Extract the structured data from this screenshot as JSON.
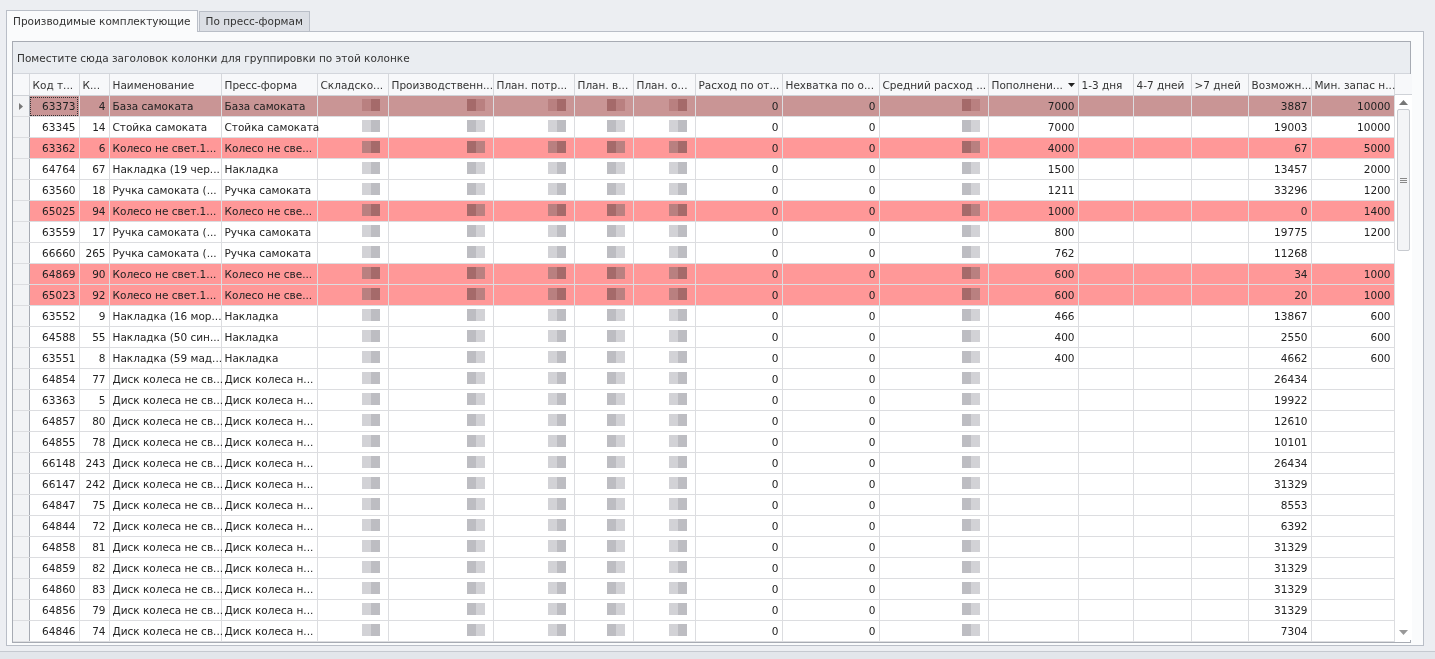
{
  "tabs": [
    {
      "label": "Производимые комплектующие",
      "selected": true
    },
    {
      "label": "По пресс-формам",
      "selected": false
    }
  ],
  "group_panel": {
    "hint": "Поместите сюда заголовок колонки для группировки по этой колонке"
  },
  "columns": [
    {
      "label": "Код т...",
      "kind": "number",
      "sorted": false
    },
    {
      "label": "К...",
      "kind": "number",
      "sorted": false
    },
    {
      "label": "Наименование",
      "kind": "text",
      "sorted": false
    },
    {
      "label": "Пресс-форма",
      "kind": "text",
      "sorted": false
    },
    {
      "label": "Складско...",
      "kind": "redacted",
      "sorted": false
    },
    {
      "label": "Производственн...",
      "kind": "redacted",
      "sorted": false
    },
    {
      "label": "План. потр...",
      "kind": "redacted",
      "sorted": false
    },
    {
      "label": "План. в...",
      "kind": "redacted",
      "sorted": false
    },
    {
      "label": "План. о...",
      "kind": "redacted",
      "sorted": false
    },
    {
      "label": "Расход по от...",
      "kind": "number",
      "sorted": false
    },
    {
      "label": "Нехватка по о...",
      "kind": "number",
      "sorted": false
    },
    {
      "label": "Средний расход ...",
      "kind": "redacted",
      "sorted": false
    },
    {
      "label": "Пополнени...",
      "kind": "number",
      "sorted": true
    },
    {
      "label": "1-3 дня",
      "kind": "number",
      "sorted": false
    },
    {
      "label": "4-7 дней",
      "kind": "number",
      "sorted": false
    },
    {
      "label": ">7 дней",
      "kind": "number",
      "sorted": false
    },
    {
      "label": "Возможн...",
      "kind": "number",
      "sorted": false
    },
    {
      "label": "Мин. запас н...",
      "kind": "number",
      "sorted": false
    }
  ],
  "rows": [
    {
      "selected": true,
      "flagged": false,
      "cells": [
        "63373",
        "4",
        "База самоката",
        "База самоката",
        null,
        null,
        null,
        null,
        null,
        "0",
        "0",
        null,
        "7000",
        null,
        null,
        null,
        "3887",
        "10000"
      ]
    },
    {
      "selected": false,
      "flagged": false,
      "cells": [
        "63345",
        "14",
        "Стойка самоката",
        "Стойка самоката",
        null,
        null,
        null,
        null,
        null,
        "0",
        "0",
        null,
        "7000",
        null,
        null,
        null,
        "19003",
        "10000"
      ]
    },
    {
      "selected": false,
      "flagged": true,
      "cells": [
        "63362",
        "6",
        "Колесо не свет.1...",
        "Колесо не све...",
        null,
        null,
        null,
        null,
        null,
        "0",
        "0",
        null,
        "4000",
        null,
        null,
        null,
        "67",
        "5000"
      ]
    },
    {
      "selected": false,
      "flagged": false,
      "cells": [
        "64764",
        "67",
        "Накладка (19 чер...",
        "Накладка",
        null,
        null,
        null,
        null,
        null,
        "0",
        "0",
        null,
        "1500",
        null,
        null,
        null,
        "13457",
        "2000"
      ]
    },
    {
      "selected": false,
      "flagged": false,
      "cells": [
        "63560",
        "18",
        "Ручка самоката (...",
        "Ручка самоката",
        null,
        null,
        null,
        null,
        null,
        "0",
        "0",
        null,
        "1211",
        null,
        null,
        null,
        "33296",
        "1200"
      ]
    },
    {
      "selected": false,
      "flagged": true,
      "cells": [
        "65025",
        "94",
        "Колесо не свет.1...",
        "Колесо не све...",
        null,
        null,
        null,
        null,
        null,
        "0",
        "0",
        null,
        "1000",
        null,
        null,
        null,
        "0",
        "1400"
      ]
    },
    {
      "selected": false,
      "flagged": false,
      "cells": [
        "63559",
        "17",
        "Ручка самоката (...",
        "Ручка самоката",
        null,
        null,
        null,
        null,
        null,
        "0",
        "0",
        null,
        "800",
        null,
        null,
        null,
        "19775",
        "1200"
      ]
    },
    {
      "selected": false,
      "flagged": false,
      "cells": [
        "66660",
        "265",
        "Ручка самоката (...",
        "Ручка самоката",
        null,
        null,
        null,
        null,
        null,
        "0",
        "0",
        null,
        "762",
        null,
        null,
        null,
        "11268",
        null
      ]
    },
    {
      "selected": false,
      "flagged": true,
      "cells": [
        "64869",
        "90",
        "Колесо не свет.1...",
        "Колесо не све...",
        null,
        null,
        null,
        null,
        null,
        "0",
        "0",
        null,
        "600",
        null,
        null,
        null,
        "34",
        "1000"
      ]
    },
    {
      "selected": false,
      "flagged": true,
      "cells": [
        "65023",
        "92",
        "Колесо не свет.1...",
        "Колесо не све...",
        null,
        null,
        null,
        null,
        null,
        "0",
        "0",
        null,
        "600",
        null,
        null,
        null,
        "20",
        "1000"
      ]
    },
    {
      "selected": false,
      "flagged": false,
      "cells": [
        "63552",
        "9",
        "Накладка (16 мор...",
        "Накладка",
        null,
        null,
        null,
        null,
        null,
        "0",
        "0",
        null,
        "466",
        null,
        null,
        null,
        "13867",
        "600"
      ]
    },
    {
      "selected": false,
      "flagged": false,
      "cells": [
        "64588",
        "55",
        "Накладка (50 син...",
        "Накладка",
        null,
        null,
        null,
        null,
        null,
        "0",
        "0",
        null,
        "400",
        null,
        null,
        null,
        "2550",
        "600"
      ]
    },
    {
      "selected": false,
      "flagged": false,
      "cells": [
        "63551",
        "8",
        "Накладка (59 мад...",
        "Накладка",
        null,
        null,
        null,
        null,
        null,
        "0",
        "0",
        null,
        "400",
        null,
        null,
        null,
        "4662",
        "600"
      ]
    },
    {
      "selected": false,
      "flagged": false,
      "cells": [
        "64854",
        "77",
        "Диск колеса не св...",
        "Диск колеса н...",
        null,
        null,
        null,
        null,
        null,
        "0",
        "0",
        null,
        null,
        null,
        null,
        null,
        "26434",
        null
      ]
    },
    {
      "selected": false,
      "flagged": false,
      "cells": [
        "63363",
        "5",
        "Диск колеса не св...",
        "Диск колеса н...",
        null,
        null,
        null,
        null,
        null,
        "0",
        "0",
        null,
        null,
        null,
        null,
        null,
        "19922",
        null
      ]
    },
    {
      "selected": false,
      "flagged": false,
      "cells": [
        "64857",
        "80",
        "Диск колеса не св...",
        "Диск колеса н...",
        null,
        null,
        null,
        null,
        null,
        "0",
        "0",
        null,
        null,
        null,
        null,
        null,
        "12610",
        null
      ]
    },
    {
      "selected": false,
      "flagged": false,
      "cells": [
        "64855",
        "78",
        "Диск колеса не св...",
        "Диск колеса н...",
        null,
        null,
        null,
        null,
        null,
        "0",
        "0",
        null,
        null,
        null,
        null,
        null,
        "10101",
        null
      ]
    },
    {
      "selected": false,
      "flagged": false,
      "cells": [
        "66148",
        "243",
        "Диск колеса не св...",
        "Диск колеса н...",
        null,
        null,
        null,
        null,
        null,
        "0",
        "0",
        null,
        null,
        null,
        null,
        null,
        "26434",
        null
      ]
    },
    {
      "selected": false,
      "flagged": false,
      "cells": [
        "66147",
        "242",
        "Диск колеса не св...",
        "Диск колеса н...",
        null,
        null,
        null,
        null,
        null,
        "0",
        "0",
        null,
        null,
        null,
        null,
        null,
        "31329",
        null
      ]
    },
    {
      "selected": false,
      "flagged": false,
      "cells": [
        "64847",
        "75",
        "Диск колеса не св...",
        "Диск колеса н...",
        null,
        null,
        null,
        null,
        null,
        "0",
        "0",
        null,
        null,
        null,
        null,
        null,
        "8553",
        null
      ]
    },
    {
      "selected": false,
      "flagged": false,
      "cells": [
        "64844",
        "72",
        "Диск колеса не св...",
        "Диск колеса н...",
        null,
        null,
        null,
        null,
        null,
        "0",
        "0",
        null,
        null,
        null,
        null,
        null,
        "6392",
        null
      ]
    },
    {
      "selected": false,
      "flagged": false,
      "cells": [
        "64858",
        "81",
        "Диск колеса не св...",
        "Диск колеса н...",
        null,
        null,
        null,
        null,
        null,
        "0",
        "0",
        null,
        null,
        null,
        null,
        null,
        "31329",
        null
      ]
    },
    {
      "selected": false,
      "flagged": false,
      "cells": [
        "64859",
        "82",
        "Диск колеса не св...",
        "Диск колеса н...",
        null,
        null,
        null,
        null,
        null,
        "0",
        "0",
        null,
        null,
        null,
        null,
        null,
        "31329",
        null
      ]
    },
    {
      "selected": false,
      "flagged": false,
      "cells": [
        "64860",
        "83",
        "Диск колеса не св...",
        "Диск колеса н...",
        null,
        null,
        null,
        null,
        null,
        "0",
        "0",
        null,
        null,
        null,
        null,
        null,
        "31329",
        null
      ]
    },
    {
      "selected": false,
      "flagged": false,
      "cells": [
        "64856",
        "79",
        "Диск колеса не св...",
        "Диск колеса н...",
        null,
        null,
        null,
        null,
        null,
        "0",
        "0",
        null,
        null,
        null,
        null,
        null,
        "31329",
        null
      ]
    },
    {
      "selected": false,
      "flagged": false,
      "cells": [
        "64846",
        "74",
        "Диск колеса не св...",
        "Диск колеса н...",
        null,
        null,
        null,
        null,
        null,
        "0",
        "0",
        null,
        null,
        null,
        null,
        null,
        "7304",
        null
      ]
    }
  ]
}
